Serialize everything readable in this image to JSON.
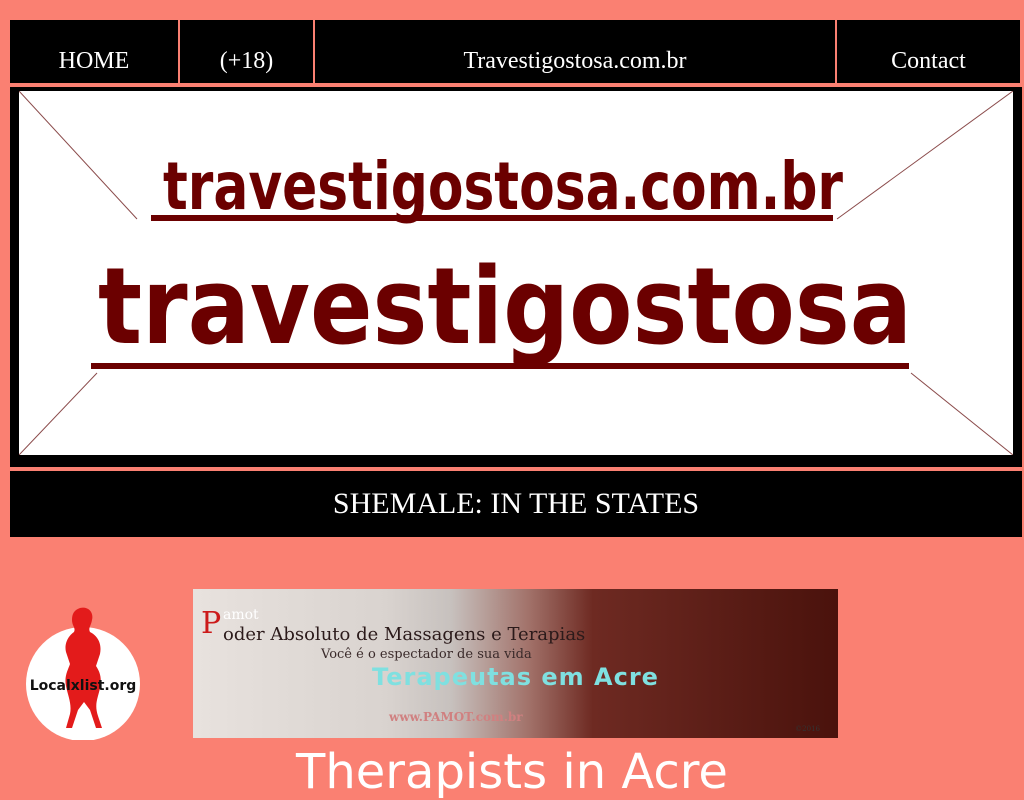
{
  "nav": {
    "items": [
      "HOME",
      "(+18)",
      "Travestigostosa.com.br",
      "Contact"
    ]
  },
  "banner": {
    "line1": "travestigostosa.com.br",
    "line2": "travestigostosa"
  },
  "title_bar": "SHEMALE: IN THE STATES",
  "badge": {
    "label": "Localxlist.org"
  },
  "ad": {
    "p_letter": "P",
    "amot": "amot",
    "line1": "oder Absoluto de Massagens e Terapias",
    "line2": "Você é o espectador de sua vida",
    "headline": "Terapeutas em Acre",
    "url": "www.PAMOT.com.br",
    "year": "©2016"
  },
  "heading": "Therapists in Acre",
  "colors": {
    "background": "#fa8072",
    "bar": "#000000",
    "logo": "#6b0000",
    "badge_red": "#e31b1b"
  }
}
